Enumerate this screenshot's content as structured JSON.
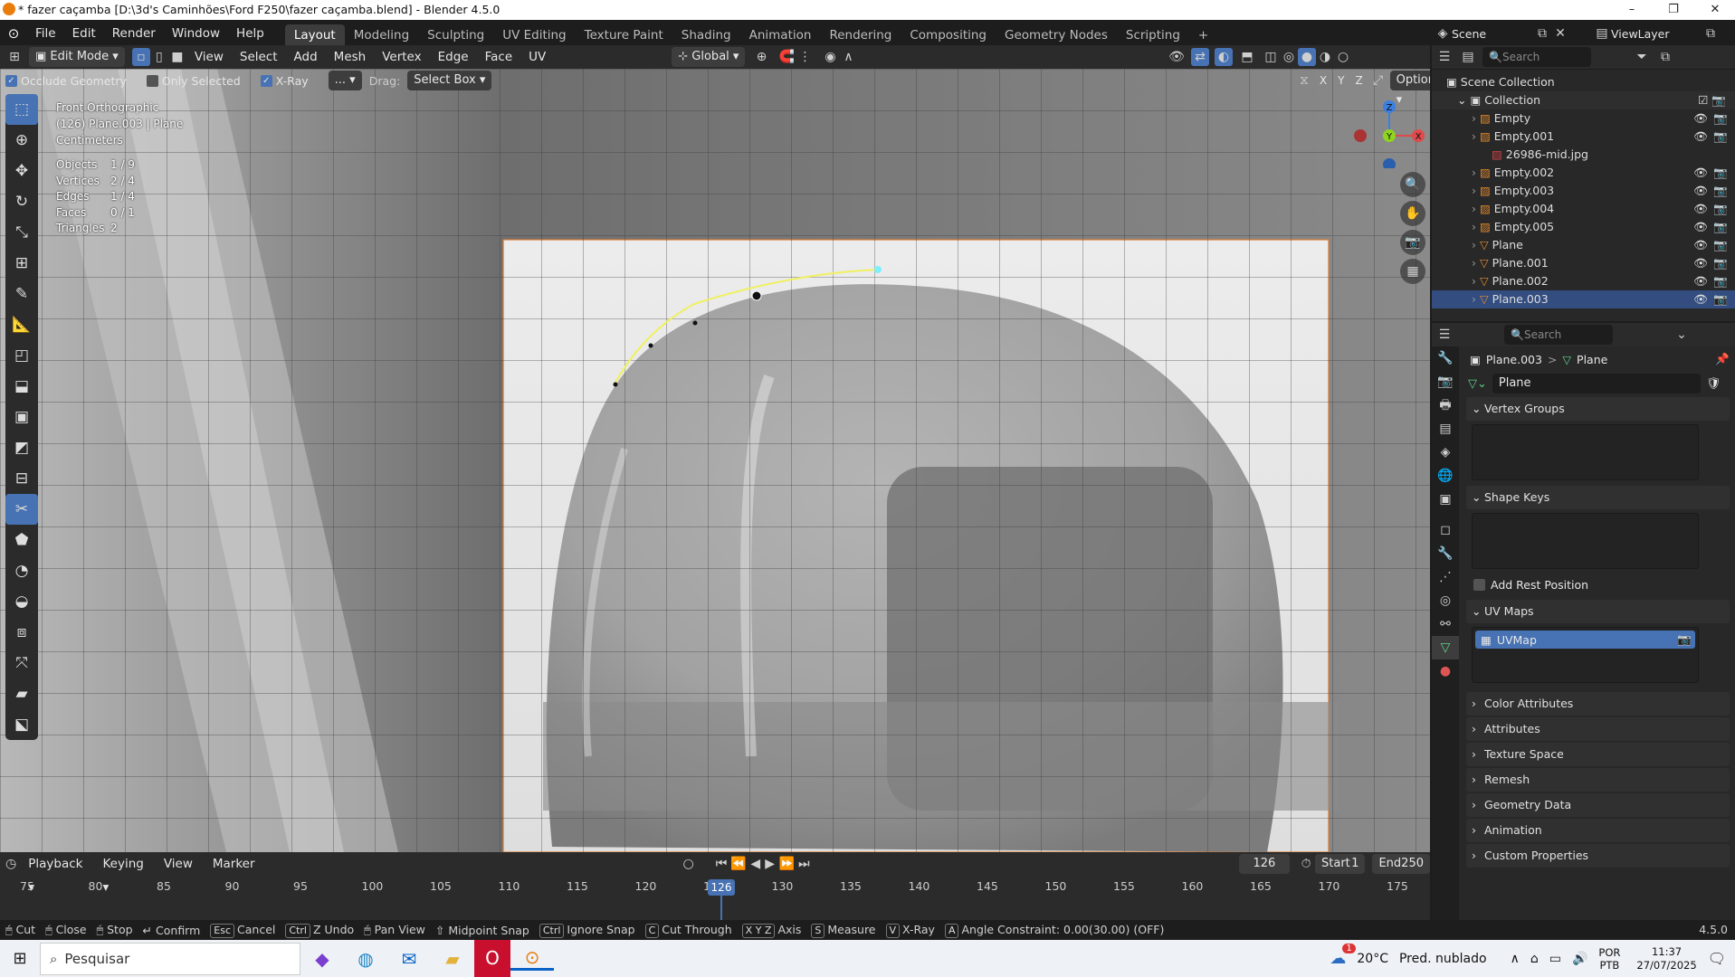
{
  "window": {
    "title": "* fazer caçamba [D:\\3d's Caminhões\\Ford F250\\fazer caçamba.blend] - Blender 4.5.0",
    "minimize": "–",
    "maximize": "❐",
    "close": "✕"
  },
  "menubar": {
    "items": [
      "File",
      "Edit",
      "Render",
      "Window",
      "Help"
    ],
    "workspaces": [
      "Layout",
      "Modeling",
      "Sculpting",
      "UV Editing",
      "Texture Paint",
      "Shading",
      "Animation",
      "Rendering",
      "Compositing",
      "Geometry Nodes",
      "Scripting"
    ],
    "add_tab": "+",
    "scene": "Scene",
    "view_layer": "ViewLayer"
  },
  "viewport_header": {
    "mode": "Edit Mode",
    "menus": [
      "View",
      "Select",
      "Add",
      "Mesh",
      "Vertex",
      "Edge",
      "Face",
      "UV"
    ],
    "orientation": "Global"
  },
  "tool_header": {
    "occlude_geometry": "Occlude Geometry",
    "only_selected": "Only Selected",
    "xray": "X-Ray",
    "dots": "...",
    "drag_label": "Drag:",
    "drag_value": "Select Box",
    "axes": [
      "X",
      "Y",
      "Z"
    ],
    "options": "Options"
  },
  "viewport": {
    "view_name": "Front Orthographic",
    "object_info": "(126) Plane.003 | Plane",
    "units": "Centimeters",
    "stats": [
      {
        "label": "Objects",
        "value": "1 / 9"
      },
      {
        "label": "Vertices",
        "value": "2 / 4"
      },
      {
        "label": "Edges",
        "value": "1 / 4"
      },
      {
        "label": "Faces",
        "value": "0 / 1"
      },
      {
        "label": "Triangles",
        "value": "2"
      }
    ],
    "gizmo": {
      "z": "Z",
      "y": "Y",
      "x": "X"
    }
  },
  "timeline": {
    "menus": [
      "Playback",
      "Keying",
      "View",
      "Marker"
    ],
    "current_frame": "126",
    "start_label": "Start",
    "start": "1",
    "end_label": "End",
    "end": "250",
    "ticks": [
      "75",
      "80",
      "85",
      "90",
      "95",
      "100",
      "105",
      "110",
      "115",
      "120",
      "12",
      "130",
      "135",
      "140",
      "145",
      "150",
      "155",
      "160",
      "165",
      "170",
      "175"
    ],
    "playhead": "126"
  },
  "statusbar": {
    "items": [
      {
        "key": "",
        "label": "Cut"
      },
      {
        "key": "",
        "label": "Close"
      },
      {
        "key": "",
        "label": "Stop"
      },
      {
        "key": "",
        "label": "Confirm"
      },
      {
        "key": "Esc",
        "label": "Cancel"
      },
      {
        "key": "Ctrl",
        "label": "Z Undo"
      },
      {
        "key": "",
        "label": "Pan View"
      },
      {
        "key": "",
        "label": "Midpoint Snap"
      },
      {
        "key": "Ctrl",
        "label": "Ignore Snap"
      },
      {
        "key": "C",
        "label": "Cut Through"
      },
      {
        "key": "X Y Z",
        "label": "Axis"
      },
      {
        "key": "S",
        "label": "Measure"
      },
      {
        "key": "V",
        "label": "X-Ray"
      },
      {
        "key": "A",
        "label": "Angle Constraint: 0.00(30.00) (OFF)"
      }
    ],
    "version": "4.5.0"
  },
  "outliner": {
    "search_placeholder": "Search",
    "scene_collection": "Scene Collection",
    "collection": "Collection",
    "items": [
      {
        "name": "Empty",
        "type": "empty"
      },
      {
        "name": "Empty.001",
        "type": "empty"
      },
      {
        "name": "26986-mid.jpg",
        "type": "image"
      },
      {
        "name": "Empty.002",
        "type": "empty"
      },
      {
        "name": "Empty.003",
        "type": "empty"
      },
      {
        "name": "Empty.004",
        "type": "empty"
      },
      {
        "name": "Empty.005",
        "type": "empty"
      },
      {
        "name": "Plane",
        "type": "mesh"
      },
      {
        "name": "Plane.001",
        "type": "mesh"
      },
      {
        "name": "Plane.002",
        "type": "mesh"
      },
      {
        "name": "Plane.003",
        "type": "mesh"
      }
    ]
  },
  "properties": {
    "search_placeholder": "Search",
    "breadcrumb_object": "Plane.003",
    "breadcrumb_sep": ">",
    "breadcrumb_data": "Plane",
    "data_name": "Plane",
    "vertex_groups": "Vertex Groups",
    "shape_keys": "Shape Keys",
    "add_rest_position": "Add Rest Position",
    "uv_maps": "UV Maps",
    "uv_map_item": "UVMap",
    "collapsed_panels": [
      "Color Attributes",
      "Attributes",
      "Texture Space",
      "Remesh",
      "Geometry Data",
      "Animation",
      "Custom Properties"
    ]
  },
  "taskbar": {
    "search_placeholder": "Pesquisar",
    "weather_temp": "20°C",
    "weather_desc": "Pred. nublado",
    "lang1": "POR",
    "lang2": "PTB",
    "time": "11:37",
    "date": "27/07/2025",
    "badge": "1"
  },
  "colors": {
    "accent": "#4772b3",
    "active_workspace": "#3d3d3d",
    "selection_yellow": "#f0f060",
    "outline_orange": "#e0772d"
  }
}
